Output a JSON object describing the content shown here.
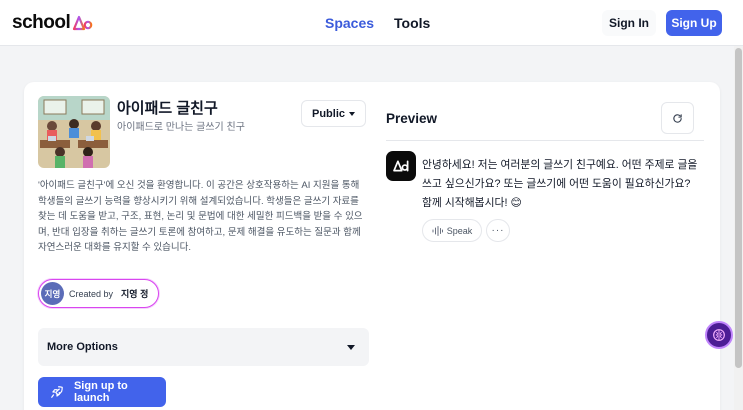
{
  "header": {
    "logo_text": "school",
    "nav": [
      {
        "label": "Spaces",
        "active": true
      },
      {
        "label": "Tools",
        "active": false
      }
    ],
    "signin_label": "Sign In",
    "signup_label": "Sign Up"
  },
  "space": {
    "title": "아이패드 글친구",
    "subtitle": "아이패드로 만나는 글쓰기 친구",
    "visibility": "Public",
    "description": "'아이패드 글친구'에 오신 것을 환영합니다. 이 공간은 상호작용하는 AI 지원을 통해 학생들의 글쓰기 능력을 향상시키기 위해 설계되었습니다. 학생들은 글쓰기 자료를 찾는 데 도움을 받고, 구조, 표현, 논리 및 문법에 대한 세밀한 피드백을 받을 수 있으며, 반대 입장을 취하는 글쓰기 토론에 참여하고, 문제 해결을 유도하는 질문과 함께 자연스러운 대화를 유지할 수 있습니다.",
    "creator": {
      "avatar_text": "지영",
      "created_by_label": "Created by",
      "name": "지영 정"
    },
    "more_options_label": "More Options",
    "launch_label": "Sign up to launch"
  },
  "preview": {
    "title": "Preview",
    "message": "안녕하세요! 저는 여러분의 글쓰기 친구예요. 어떤 주제로 글을 쓰고 싶으신가요? 또는 글쓰기에 어떤 도움이 필요하신가요? 함께 시작해봅시다! 😊",
    "speak_label": "Speak",
    "more_label": "···"
  },
  "icons": {
    "logo_mark": "ai-logo-mark",
    "refresh": "refresh-icon",
    "speak": "audio-wave-icon",
    "launch": "rocket-icon",
    "helper": "brain-icon"
  },
  "colors": {
    "accent": "#4263eb",
    "active_nav": "#3b5bdb",
    "creator_border": "#d946ef"
  }
}
